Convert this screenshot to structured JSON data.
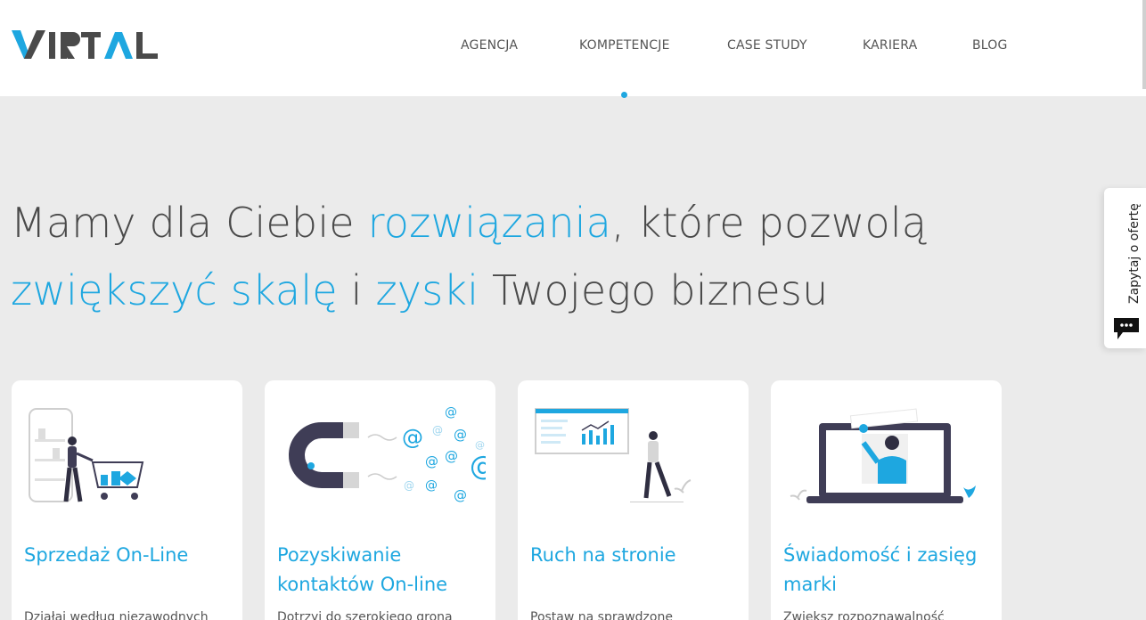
{
  "brand": {
    "logo_text": "VIRTAL",
    "accent_color": "#1ea7e0"
  },
  "nav": {
    "items": [
      {
        "label": "AGENCJA"
      },
      {
        "label": "KOMPETENCJE"
      },
      {
        "label": "CASE STUDY"
      },
      {
        "label": "KARIERA"
      },
      {
        "label": "BLOG"
      }
    ],
    "active_index": 1
  },
  "hero": {
    "line1_a": "Mamy dla Ciebie ",
    "line1_b": "rozwiązania",
    "line1_c": ", które pozwolą",
    "line2_a": "zwiększyć skalę",
    "line2_b": " i ",
    "line2_c": "zyski",
    "line2_d": " Twojego biznesu"
  },
  "side_tab": {
    "label": "Zapytaj o ofertę",
    "icon": "chat-bubble-icon"
  },
  "cards": [
    {
      "title": "Sprzedaż On-Line",
      "description": "Działaj według niezawodnych",
      "icon": "shopping-cart-illustration"
    },
    {
      "title": "Pozyskiwanie kontaktów On-line",
      "description": "Dotrzyj do szerokiego grona",
      "icon": "magnet-illustration"
    },
    {
      "title": "Ruch na stronie",
      "description": "Postaw na sprawdzone",
      "icon": "analytics-chart-illustration"
    },
    {
      "title": "Świadomość i zasięg marki",
      "description": "Zwiększ rozpoznawalność",
      "icon": "laptop-person-illustration"
    }
  ]
}
